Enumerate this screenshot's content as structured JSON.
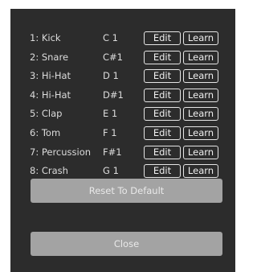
{
  "mappings": [
    {
      "name": "1: Kick",
      "note": "C 1"
    },
    {
      "name": "2: Snare",
      "note": "C#1"
    },
    {
      "name": "3: Hi-Hat",
      "note": "D 1"
    },
    {
      "name": "4: Hi-Hat",
      "note": "D#1"
    },
    {
      "name": "5: Clap",
      "note": "E 1"
    },
    {
      "name": "6: Tom",
      "note": "F 1"
    },
    {
      "name": "7: Percussion",
      "note": "F#1"
    },
    {
      "name": "8: Crash",
      "note": "G 1"
    }
  ],
  "buttons": {
    "edit_label": "Edit",
    "learn_label": "Learn",
    "reset_label": "Reset To Default",
    "close_label": "Close"
  },
  "colors": {
    "panel_bg": "#2c2c2c",
    "text": "#dcdcdc",
    "button_border": "#e6e6e6",
    "big_button_bg": "#a3a3a3"
  }
}
